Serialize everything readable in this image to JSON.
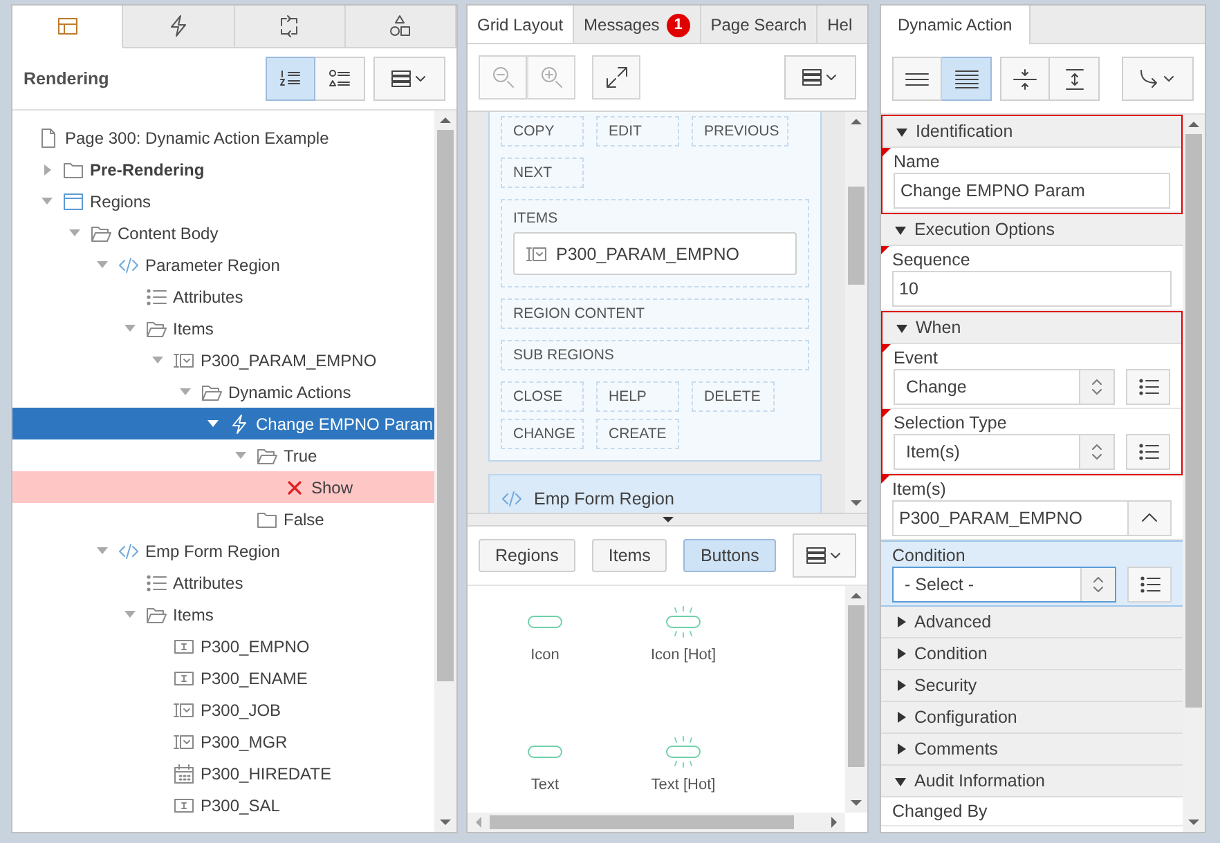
{
  "left": {
    "tabs": [
      {
        "kind": "rendering",
        "selected": true
      },
      {
        "kind": "dynamic-actions",
        "selected": false
      },
      {
        "kind": "processing",
        "selected": false
      },
      {
        "kind": "shared-components",
        "selected": false
      }
    ],
    "title": "Rendering",
    "views": [
      {
        "kind": "ordered",
        "selected": true
      },
      {
        "kind": "grouped",
        "selected": false
      }
    ],
    "tree": [
      {
        "label": "Page 300: Dynamic Action Example",
        "kind": "page",
        "selected": false,
        "children": [
          {
            "label": "Pre-Rendering",
            "kind": "folder",
            "expanded": false,
            "bold": true,
            "selected": false
          },
          {
            "label": "Regions",
            "kind": "region",
            "expanded": true,
            "selected": false,
            "children": [
              {
                "label": "Content Body",
                "kind": "folder-open",
                "expanded": true,
                "selected": false,
                "children": [
                  {
                    "label": "Parameter Region",
                    "kind": "code",
                    "expanded": true,
                    "selected": false,
                    "children": [
                      {
                        "label": "Attributes",
                        "kind": "attributes",
                        "selected": false
                      },
                      {
                        "label": "Items",
                        "kind": "folder-open",
                        "expanded": true,
                        "selected": false,
                        "children": [
                          {
                            "label": "P300_PARAM_EMPNO",
                            "kind": "select-item",
                            "expanded": true,
                            "selected": false,
                            "children": [
                              {
                                "label": "Dynamic Actions",
                                "kind": "folder-open",
                                "expanded": true,
                                "selected": false,
                                "children": [
                                  {
                                    "label": "Change EMPNO Param",
                                    "kind": "lightning",
                                    "expanded": true,
                                    "selected": true,
                                    "children": [
                                      {
                                        "label": "True",
                                        "kind": "folder-open",
                                        "expanded": true,
                                        "selected": false,
                                        "children": [
                                          {
                                            "label": "Show",
                                            "kind": "action",
                                            "error": true,
                                            "selected": false
                                          }
                                        ]
                                      },
                                      {
                                        "label": "False",
                                        "kind": "folder",
                                        "selected": false
                                      }
                                    ]
                                  }
                                ]
                              }
                            ]
                          }
                        ]
                      }
                    ]
                  },
                  {
                    "label": "Emp Form Region",
                    "kind": "code",
                    "expanded": true,
                    "selected": false,
                    "children": [
                      {
                        "label": "Attributes",
                        "kind": "attributes",
                        "selected": false
                      },
                      {
                        "label": "Items",
                        "kind": "folder-open",
                        "expanded": true,
                        "selected": false,
                        "children": [
                          {
                            "label": "P300_EMPNO",
                            "kind": "text-item",
                            "selected": false
                          },
                          {
                            "label": "P300_ENAME",
                            "kind": "text-item",
                            "selected": false
                          },
                          {
                            "label": "P300_JOB",
                            "kind": "select-item",
                            "selected": false
                          },
                          {
                            "label": "P300_MGR",
                            "kind": "select-item",
                            "selected": false
                          },
                          {
                            "label": "P300_HIREDATE",
                            "kind": "date-item",
                            "selected": false
                          },
                          {
                            "label": "P300_SAL",
                            "kind": "text-item",
                            "selected": false
                          }
                        ]
                      }
                    ]
                  }
                ]
              }
            ]
          }
        ]
      }
    ]
  },
  "middle": {
    "tabs": [
      {
        "label": "Grid Layout",
        "selected": true
      },
      {
        "label": "Messages",
        "selected": false,
        "badge": "1"
      },
      {
        "label": "Page Search",
        "selected": false
      },
      {
        "label": "Hel",
        "selected": false
      }
    ],
    "tools": [
      {
        "kind": "zoom-out",
        "disabled": true
      },
      {
        "kind": "zoom-in",
        "disabled": true
      },
      {
        "kind": "expand",
        "disabled": false
      }
    ],
    "layout": {
      "sections": [
        {
          "kind": "positions",
          "labels": [
            "COPY",
            "EDIT",
            "PREVIOUS",
            "NEXT"
          ]
        },
        {
          "kind": "items",
          "label": "ITEMS",
          "items": [
            "P300_PARAM_EMPNO"
          ]
        },
        {
          "kind": "slot",
          "label": "REGION CONTENT"
        },
        {
          "kind": "slot",
          "label": "SUB REGIONS"
        },
        {
          "kind": "positions",
          "labels": [
            "CLOSE",
            "HELP",
            "DELETE",
            "CHANGE",
            "CREATE"
          ]
        }
      ],
      "next_region": "Emp Form Region"
    },
    "gallery": {
      "tabs": [
        {
          "label": "Regions",
          "selected": false
        },
        {
          "label": "Items",
          "selected": false
        },
        {
          "label": "Buttons",
          "selected": true
        }
      ],
      "entries": [
        {
          "label": "Icon",
          "hot": false
        },
        {
          "label": "Icon [Hot]",
          "hot": true
        },
        {
          "label": "Text",
          "hot": false
        },
        {
          "label": "Text [Hot]",
          "hot": true
        }
      ]
    }
  },
  "right": {
    "tab": "Dynamic Action",
    "tools": [
      {
        "kind": "wide",
        "selected": false
      },
      {
        "kind": "dense",
        "selected": true
      },
      {
        "kind": "collapse",
        "selected": false
      },
      {
        "kind": "expand",
        "selected": false
      }
    ],
    "groups": [
      {
        "title": "Identification",
        "expanded": true,
        "outlined": true,
        "properties": [
          {
            "label": "Name",
            "kind": "text",
            "value": "Change EMPNO Param",
            "required": true,
            "selected": false,
            "outlined": true
          }
        ]
      },
      {
        "title": "Execution Options",
        "expanded": true,
        "outlined": false,
        "properties": [
          {
            "label": "Sequence",
            "kind": "text",
            "value": "10",
            "required": true,
            "selected": false
          }
        ]
      },
      {
        "title": "When",
        "expanded": true,
        "outlined": true,
        "properties": [
          {
            "label": "Event",
            "kind": "select",
            "value": "Change",
            "required": true,
            "selected": false,
            "outlined": true
          },
          {
            "label": "Selection Type",
            "kind": "select",
            "value": "Item(s)",
            "required": true,
            "selected": false,
            "outlined": true
          },
          {
            "label": "Item(s)",
            "kind": "popup",
            "value": "P300_PARAM_EMPNO",
            "required": true,
            "selected": false,
            "outlined": false
          },
          {
            "label": "Condition",
            "kind": "select",
            "value": "- Select -",
            "required": false,
            "selected": true,
            "outlined": false
          }
        ]
      },
      {
        "title": "Advanced",
        "expanded": false,
        "outlined": false
      },
      {
        "title": "Condition",
        "expanded": false,
        "outlined": false
      },
      {
        "title": "Security",
        "expanded": false,
        "outlined": false
      },
      {
        "title": "Configuration",
        "expanded": false,
        "outlined": false
      },
      {
        "title": "Comments",
        "expanded": false,
        "outlined": false
      },
      {
        "title": "Audit Information",
        "expanded": true,
        "outlined": false,
        "properties": [
          {
            "label": "Changed By",
            "kind": "label",
            "required": false,
            "selected": false
          }
        ]
      }
    ]
  }
}
